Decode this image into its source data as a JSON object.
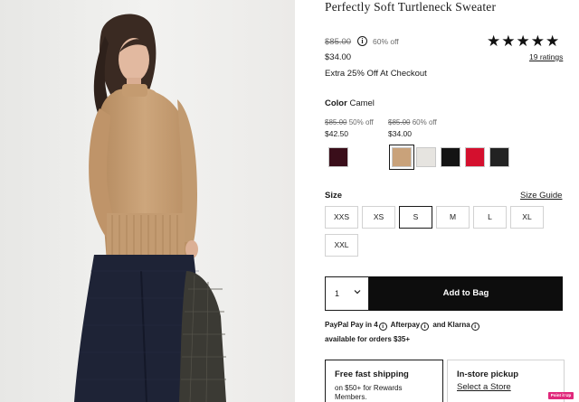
{
  "product": {
    "title": "Perfectly Soft Turtleneck Sweater",
    "original_price": "$85.00",
    "discount_percent": "60% off",
    "sale_price": "$34.00",
    "promo": "Extra 25% Off At Checkout",
    "rating": 5,
    "ratings_count": "19 ratings"
  },
  "color": {
    "label": "Color",
    "selected": "Camel",
    "price_groups": [
      {
        "original": "$85.00",
        "off": "50% off",
        "now": "$42.50"
      },
      {
        "original": "$85.00",
        "off": "60% off",
        "now": "$34.00"
      }
    ],
    "swatches": [
      {
        "name": "burgundy",
        "hex": "#3a0e1a",
        "selected": false
      },
      {
        "name": "camel",
        "hex": "#c9a27a",
        "selected": true
      },
      {
        "name": "ivory",
        "hex": "#e6e4e0",
        "selected": false
      },
      {
        "name": "black",
        "hex": "#141414",
        "selected": false
      },
      {
        "name": "red",
        "hex": "#d4102e",
        "selected": false
      },
      {
        "name": "charcoal",
        "hex": "#222222",
        "selected": false
      }
    ]
  },
  "size": {
    "label": "Size",
    "guide_link": "Size Guide",
    "options": [
      "XXS",
      "XS",
      "S",
      "M",
      "L",
      "XL",
      "XXL"
    ],
    "selected": "S"
  },
  "cart": {
    "quantity": "1",
    "add_label": "Add to Bag"
  },
  "payment": {
    "line1_a": "PayPal Pay in 4",
    "line1_b": "Afterpay",
    "line1_c": "and Klarna",
    "line2": "available for orders $35+"
  },
  "fulfillment": {
    "shipping_title": "Free fast shipping",
    "shipping_sub_1": "on $50+ for Rewards",
    "shipping_sub_2": "Members.",
    "pickup_title": "In-store pickup",
    "pickup_link": "Select a Store"
  },
  "badge": "Point it Up",
  "colors": {
    "accent": "#0d0d0d",
    "badge": "#e0287b"
  }
}
